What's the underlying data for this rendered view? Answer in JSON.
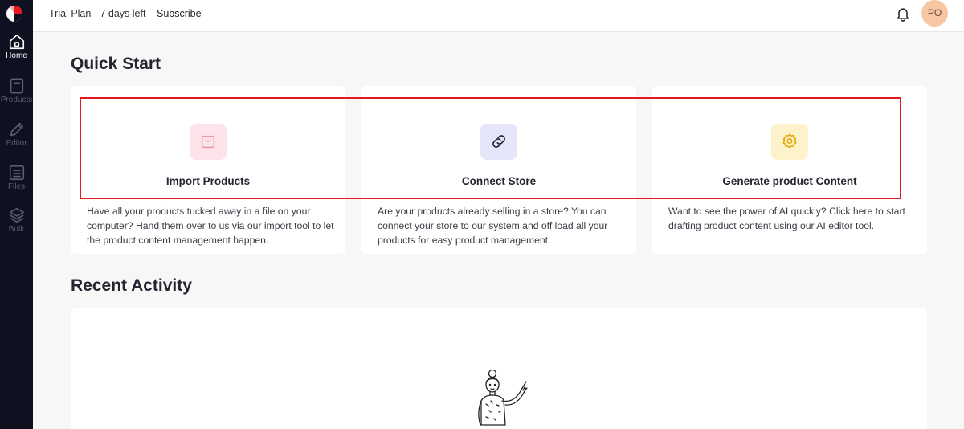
{
  "sidebar": {
    "items": [
      {
        "label": "Home",
        "icon": "home-icon",
        "active": true
      },
      {
        "label": "Products",
        "icon": "products-icon",
        "active": false
      },
      {
        "label": "Editor",
        "icon": "pencil-icon",
        "active": false
      },
      {
        "label": "Files",
        "icon": "files-icon",
        "active": false
      },
      {
        "label": "Bulk",
        "icon": "layers-icon",
        "active": false
      }
    ]
  },
  "header": {
    "plan_text": "Trial Plan - 7 days left",
    "subscribe_label": "Subscribe",
    "avatar_initials": "PO"
  },
  "quick_start": {
    "title": "Quick Start",
    "cards": [
      {
        "title": "Import Products",
        "description": "Have all your products tucked away in a file on your computer? Hand them over to us via our import tool to let the product content management happen.",
        "icon": "shopping-bag-icon",
        "icon_bg": "#fde3ea"
      },
      {
        "title": "Connect Store",
        "description": "Are your products already selling in a store? You can connect your store to our system and off load all your products for easy product management.",
        "icon": "link-icon",
        "icon_bg": "#e6e6fa"
      },
      {
        "title": "Generate product Content",
        "description": "Want to see the power of AI quickly? Click here to start drafting product content using our AI editor tool.",
        "icon": "gear-icon",
        "icon_bg": "#fdf2c9"
      }
    ]
  },
  "recent_activity": {
    "title": "Recent Activity"
  },
  "colors": {
    "sidebar_bg": "#0f1020",
    "highlight": "#e3191f",
    "avatar_bg": "#f7c7a4"
  }
}
